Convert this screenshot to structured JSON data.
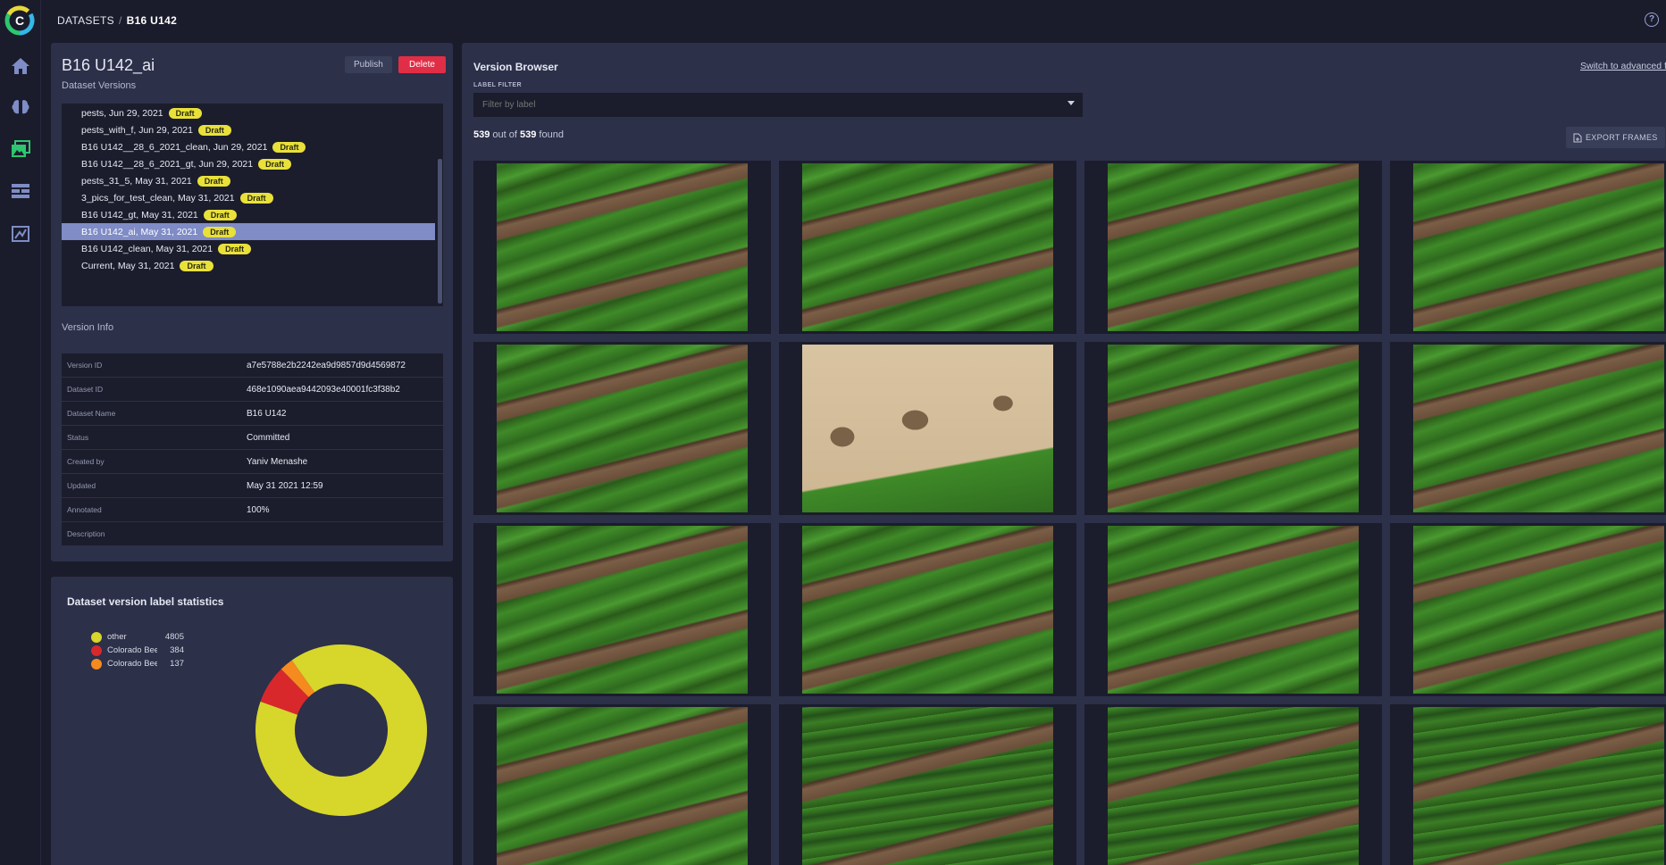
{
  "app": {
    "logo_letter": "C"
  },
  "breadcrumb": {
    "root": "DATASETS",
    "separator": "/",
    "current": "B16 U142"
  },
  "header": {
    "help_label": "?"
  },
  "dataset": {
    "title": "B16 U142_ai",
    "publish_label": "Publish",
    "delete_label": "Delete",
    "versions_heading": "Dataset Versions",
    "draft_label": "Draft",
    "versions": [
      {
        "label": "pests, Jun 29, 2021",
        "selected": false
      },
      {
        "label": "pests_with_f, Jun 29, 2021",
        "selected": false
      },
      {
        "label": "B16 U142__28_6_2021_clean, Jun 29, 2021",
        "selected": false
      },
      {
        "label": "B16 U142__28_6_2021_gt, Jun 29, 2021",
        "selected": false
      },
      {
        "label": "pests_31_5, May 31, 2021",
        "selected": false
      },
      {
        "label": "3_pics_for_test_clean, May 31, 2021",
        "selected": false
      },
      {
        "label": "B16 U142_gt, May 31, 2021",
        "selected": false
      },
      {
        "label": "B16 U142_ai, May 31, 2021",
        "selected": true
      },
      {
        "label": "B16 U142_clean, May 31, 2021",
        "selected": false
      },
      {
        "label": "Current, May 31, 2021",
        "selected": false
      }
    ],
    "version_info_heading": "Version Info",
    "info": [
      {
        "key": "Version ID",
        "value": "a7e5788e2b2242ea9d9857d9d4569872"
      },
      {
        "key": "Dataset ID",
        "value": "468e1090aea9442093e40001fc3f38b2"
      },
      {
        "key": "Dataset Name",
        "value": "B16 U142"
      },
      {
        "key": "Status",
        "value": "Committed"
      },
      {
        "key": "Created by",
        "value": "Yaniv Menashe"
      },
      {
        "key": "Updated",
        "value": "May 31 2021 12:59"
      },
      {
        "key": "Annotated",
        "value": "100%"
      },
      {
        "key": "Description",
        "value": ""
      }
    ]
  },
  "stats": {
    "title": "Dataset version label statistics",
    "labels": [
      {
        "name": "other",
        "value": 4805,
        "color": "#d7d62a"
      },
      {
        "name": "Colorado Bee",
        "value": 384,
        "color": "#d8282c"
      },
      {
        "name": "Colorado Bee",
        "value": 137,
        "color": "#f58a1f"
      }
    ]
  },
  "browser": {
    "title": "Version Browser",
    "advanced_link": "Switch to advanced f",
    "filter_label": "LABEL FILTER",
    "filter_placeholder": "Filter by label",
    "found_count": "539",
    "found_mid": " out of ",
    "found_total": "539",
    "found_suffix": " found",
    "export_label": "EXPORT FRAMES",
    "frames": [
      {
        "variant": "crop"
      },
      {
        "variant": "crop"
      },
      {
        "variant": "crop"
      },
      {
        "variant": "crop"
      },
      {
        "variant": "crop"
      },
      {
        "variant": "sand"
      },
      {
        "variant": "crop"
      },
      {
        "variant": "crop"
      },
      {
        "variant": "crop"
      },
      {
        "variant": "crop"
      },
      {
        "variant": "crop"
      },
      {
        "variant": "crop"
      },
      {
        "variant": "crop"
      },
      {
        "variant": "dense"
      },
      {
        "variant": "dense"
      },
      {
        "variant": "dense"
      }
    ]
  },
  "colors": {
    "accent": "#7f8cc6",
    "draft_badge": "#e9e13a",
    "delete": "#e02e46",
    "panel": "#2c3049",
    "background": "#1a1c2b"
  }
}
